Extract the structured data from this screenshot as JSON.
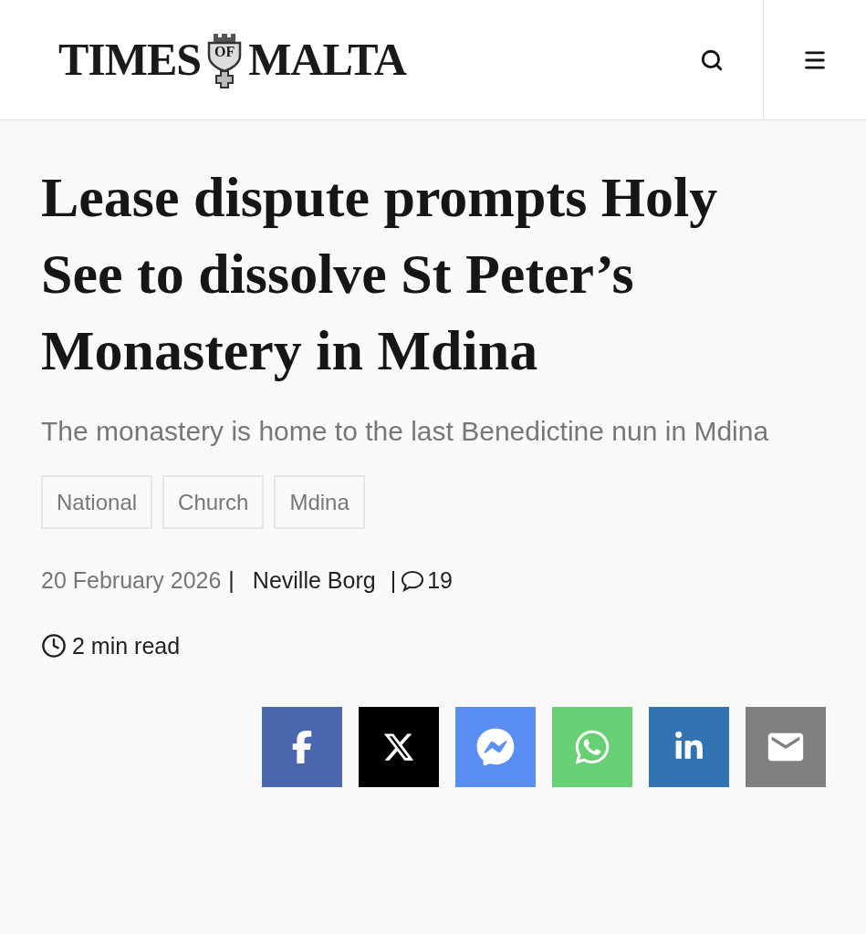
{
  "header": {
    "logo": {
      "left": "TIMES",
      "crest": "OF",
      "right": "MALTA"
    }
  },
  "article": {
    "headline": "Lease dispute prompts Holy See to dissolve St Peter’s Monastery in Mdina",
    "standfirst": "The monastery is home to the last Benedictine nun in Mdina",
    "tags": [
      "National",
      "Church",
      "Mdina"
    ],
    "date": "20 February 2026",
    "separator": "|",
    "author": "Neville Borg",
    "comments": "19",
    "read_time": "2 min read"
  },
  "share": [
    {
      "kind": "facebook"
    },
    {
      "kind": "x"
    },
    {
      "kind": "messenger"
    },
    {
      "kind": "whatsapp"
    },
    {
      "kind": "linkedin"
    },
    {
      "kind": "email"
    }
  ]
}
